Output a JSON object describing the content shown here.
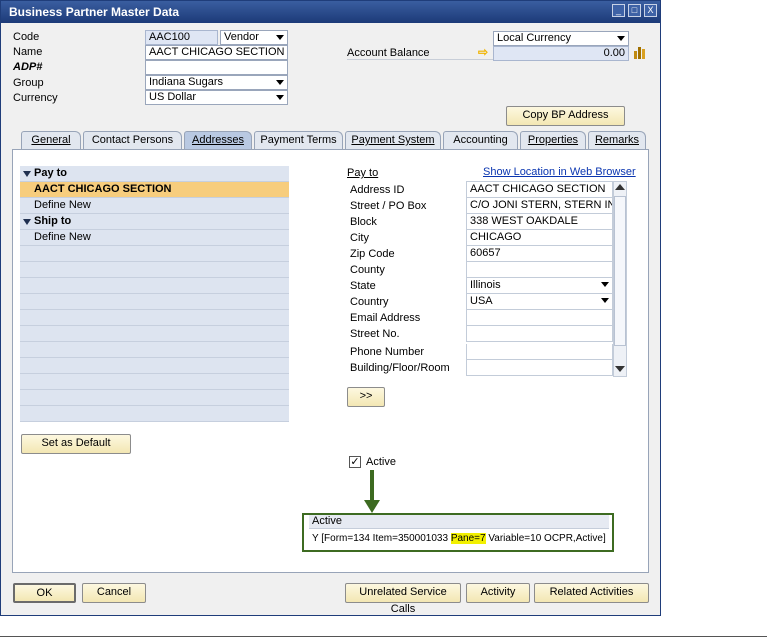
{
  "window": {
    "title": "Business Partner Master Data",
    "controls": {
      "minimize": "_",
      "maximize": "□",
      "close": "X"
    }
  },
  "header": {
    "code_label": "Code",
    "code_value": "AAC100",
    "type_value": "Vendor",
    "name_label": "Name",
    "name_value": "AACT CHICAGO SECTION",
    "adp_label": "ADP#",
    "adp_value": "",
    "group_label": "Group",
    "group_value": "Indiana Sugars",
    "currency_label": "Currency",
    "currency_value": "US Dollar",
    "local_currency_value": "Local Currency",
    "balance_label": "Account Balance",
    "balance_value": "0.00",
    "copy_button": "Copy BP Address"
  },
  "tabs": [
    {
      "label": "General",
      "active": false
    },
    {
      "label": "Contact Persons",
      "active": false
    },
    {
      "label": "Addresses",
      "active": true
    },
    {
      "label": "Payment Terms",
      "active": false
    },
    {
      "label": "Payment System",
      "active": false
    },
    {
      "label": "Accounting",
      "active": false
    },
    {
      "label": "Properties",
      "active": false
    },
    {
      "label": "Remarks",
      "active": false
    }
  ],
  "address_list": [
    {
      "label": "Pay to",
      "kind": "group"
    },
    {
      "label": "AACT CHICAGO SECTION",
      "kind": "selected"
    },
    {
      "label": "Define New",
      "kind": "item"
    },
    {
      "label": "Ship to",
      "kind": "group"
    },
    {
      "label": "Define New",
      "kind": "item"
    }
  ],
  "set_default_button": "Set as Default",
  "address_form": {
    "section_label": "Pay to",
    "map_link": "Show Location in Web Browser",
    "rows": [
      {
        "label": "Address ID",
        "value": "AACT CHICAGO SECTION"
      },
      {
        "label": "Street / PO Box",
        "value": "C/O JONI STERN, STERN INGR"
      },
      {
        "label": "Block",
        "value": "338 WEST OAKDALE"
      },
      {
        "label": "City",
        "value": "CHICAGO"
      },
      {
        "label": "Zip Code",
        "value": "60657"
      },
      {
        "label": "County",
        "value": ""
      },
      {
        "label": "State",
        "value": "Illinois"
      },
      {
        "label": "Country",
        "value": "USA"
      },
      {
        "label": "Email Address",
        "value": ""
      },
      {
        "label": "Street No.",
        "value": ""
      },
      {
        "label": "Phone Number",
        "value": ""
      },
      {
        "label": "Building/Floor/Room",
        "value": ""
      }
    ],
    "expand_button": ">>"
  },
  "active_checkbox": {
    "label": "Active",
    "checked": true
  },
  "debug_panel": {
    "title": "Active",
    "info_prefix": "Y [Form=134 Item=350001033 ",
    "info_highlight": "Pane=7",
    "info_suffix": " Variable=10 OCPR,Active]"
  },
  "footer": {
    "ok": "OK",
    "cancel": "Cancel",
    "unrelated": "Unrelated Service Calls",
    "activity": "Activity",
    "related": "Related Activities"
  },
  "colors": {
    "title_bar": "#1c3a78",
    "selected_row": "#f7cd7d",
    "highlight": "#f2f000",
    "arrow": "#3d6b21",
    "link": "#0a35b0"
  }
}
